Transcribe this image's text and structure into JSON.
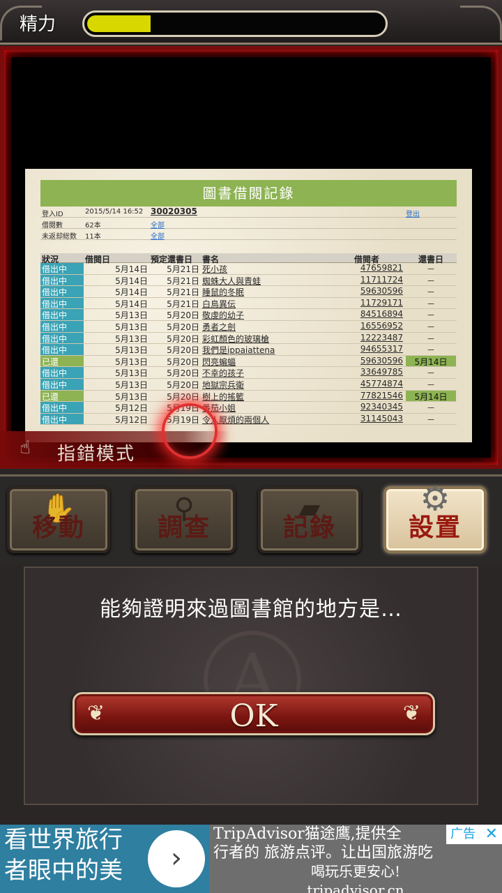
{
  "hud": {
    "stamina_label": "精力",
    "stamina_level": 0.21
  },
  "document": {
    "title": "圖書借閱記錄",
    "info": [
      {
        "key": "登入ID",
        "value": "2015/5/14 16:52",
        "extra": "30020305"
      },
      {
        "key": "借閱數",
        "value": "62本",
        "extra": "全部"
      },
      {
        "key": "未返却総数",
        "value": "11本",
        "extra": "全部"
      }
    ],
    "logout": "登出",
    "headers": {
      "status": "狀況",
      "lend": "借閱日",
      "due": "預定還書日",
      "title": "書名",
      "user": "借閱者",
      "returned": "還書日"
    },
    "rows": [
      {
        "status": "借出中",
        "lend": "5月14日",
        "due": "5月21日",
        "title": "死小孩",
        "user": "47659821",
        "returned": "－",
        "kind": "out"
      },
      {
        "status": "借出中",
        "lend": "5月14日",
        "due": "5月21日",
        "title": "蜘蛛大人與青蛙",
        "user": "11711724",
        "returned": "－",
        "kind": "out"
      },
      {
        "status": "借出中",
        "lend": "5月14日",
        "due": "5月21日",
        "title": "睡鼠的冬眠",
        "user": "59630596",
        "returned": "－",
        "kind": "out"
      },
      {
        "status": "借出中",
        "lend": "5月14日",
        "due": "5月21日",
        "title": "白鳥異伝",
        "user": "11729171",
        "returned": "－",
        "kind": "out"
      },
      {
        "status": "借出中",
        "lend": "5月13日",
        "due": "5月20日",
        "title": "敬虔的幼子",
        "user": "84516894",
        "returned": "－",
        "kind": "out"
      },
      {
        "status": "借出中",
        "lend": "5月13日",
        "due": "5月20日",
        "title": "勇者之劍",
        "user": "16556952",
        "returned": "－",
        "kind": "out"
      },
      {
        "status": "借出中",
        "lend": "5月13日",
        "due": "5月20日",
        "title": "彩虹顏色的玻璃槍",
        "user": "12223487",
        "returned": "－",
        "kind": "out"
      },
      {
        "status": "借出中",
        "lend": "5月13日",
        "due": "5月20日",
        "title": "我們是ippaiattena",
        "user": "94655317",
        "returned": "－",
        "kind": "out"
      },
      {
        "status": "已還",
        "lend": "5月13日",
        "due": "5月20日",
        "title": "閃亮蝙蝠",
        "user": "59630596",
        "returned": "5月14日",
        "kind": "ret"
      },
      {
        "status": "借出中",
        "lend": "5月13日",
        "due": "5月20日",
        "title": "不幸的孩子",
        "user": "33649785",
        "returned": "－",
        "kind": "out"
      },
      {
        "status": "借出中",
        "lend": "5月13日",
        "due": "5月20日",
        "title": "地獄宗兵衛",
        "user": "45774874",
        "returned": "－",
        "kind": "out"
      },
      {
        "status": "已還",
        "lend": "5月13日",
        "due": "5月20日",
        "title": "樹上的搖籃",
        "user": "77821546",
        "returned": "5月14日",
        "kind": "ret"
      },
      {
        "status": "借出中",
        "lend": "5月12日",
        "due": "5月19日",
        "title": "番茄小姐",
        "user": "92340345",
        "returned": "－",
        "kind": "out"
      },
      {
        "status": "借出中",
        "lend": "5月12日",
        "due": "5月19日",
        "title": "令人厭煩的兩個人",
        "user": "31145043",
        "returned": "－",
        "kind": "out"
      }
    ]
  },
  "pointer_mode": {
    "label": "指錯模式",
    "icon": "pointing-hand-icon"
  },
  "menu": {
    "move": {
      "label": "移動",
      "icon": "hand-icon"
    },
    "search": {
      "label": "調查",
      "icon": "magnifier-icon"
    },
    "record": {
      "label": "記錄",
      "icon": "folder-icon"
    },
    "settings": {
      "label": "設置",
      "icon": "gear-icon"
    }
  },
  "dialog": {
    "message": "能夠證明來過圖書館的地方是…",
    "ok_label": "OK"
  },
  "ad": {
    "left_text": "看世界旅行者眼中的美",
    "right_line1": "TripAdvisor猫途鹰,提供全",
    "right_line2": "行者的 旅游点评。让出国旅游吃",
    "right_line3": "喝玩乐更安心!",
    "right_url": "tripadvisor.cn",
    "badge": "广告"
  },
  "colors": {
    "frame_red": "#7a0c0c",
    "stamina_yellow": "#d8d800",
    "status_out": "#3aa3b5",
    "status_ret": "#8db352"
  }
}
